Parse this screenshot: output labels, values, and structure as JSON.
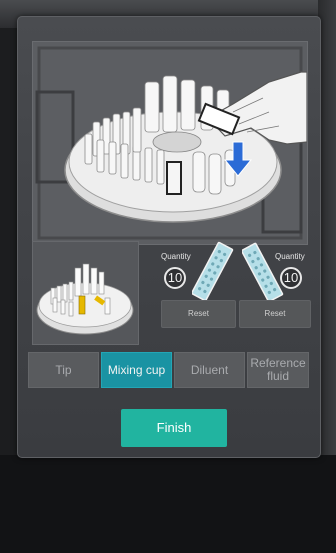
{
  "instruction_image": {
    "icon": "hand-inserting-strip-into-carousel-icon"
  },
  "thumbnail": {
    "icon": "carousel-thumbnail-icon"
  },
  "left_holder": {
    "quantity_label": "Quantity",
    "quantity_value": "10",
    "reset_label": "Reset",
    "icon": "tip-strip-icon"
  },
  "right_holder": {
    "quantity_label": "Quantity",
    "quantity_value": "10",
    "reset_label": "Reset",
    "icon": "tip-strip-icon"
  },
  "tabs": [
    {
      "label": "Tip",
      "active": false
    },
    {
      "label": "Mixing cup",
      "active": true
    },
    {
      "label": "Diluent",
      "active": false
    },
    {
      "label": "Reference fluid",
      "active": false
    }
  ],
  "finish_label": "Finish",
  "colors": {
    "active_tab": "#1a93a3",
    "finish_button": "#21b4a0",
    "arrow": "#2b6bd6",
    "highlight": "#e6b800"
  }
}
